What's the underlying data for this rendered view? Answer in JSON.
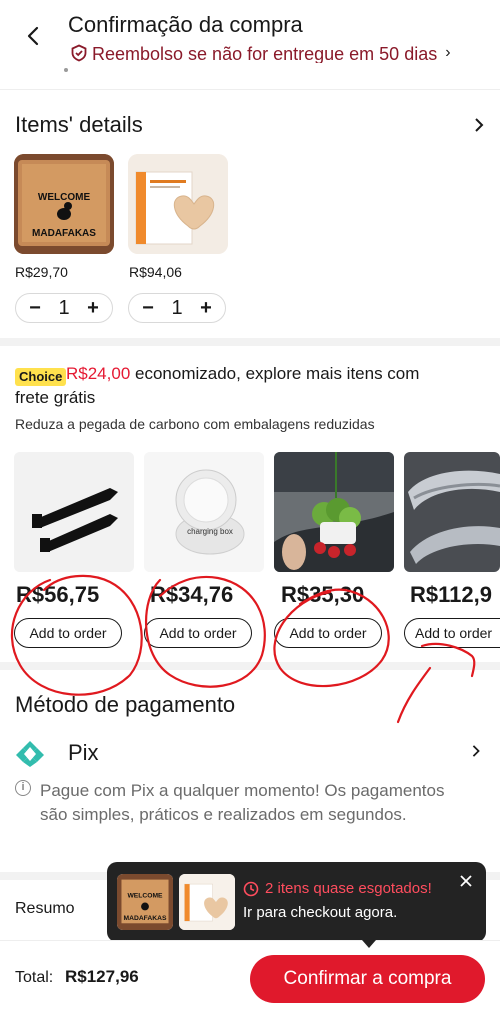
{
  "header": {
    "title": "Confirmação da compra",
    "refund_notice": "Reembolso se não for entregue em 50 dias",
    "back_icon": "chevron-left-icon"
  },
  "items": {
    "title": "Items' details",
    "products": [
      {
        "image_label": "WELCOME MADAFAKAS",
        "price": "R$29,70",
        "qty": "1"
      },
      {
        "price": "R$94,06",
        "qty": "1"
      }
    ],
    "minus": "−",
    "plus": "+"
  },
  "choice": {
    "badge": "Choice",
    "saved_amount": "R$24,00",
    "line1_rest": " economizado, explore mais itens com",
    "line2": "frete grátis",
    "subtitle": "Reduza a pegada de carbono com embalagens reduzidas",
    "recommendations": [
      {
        "price": "R$56,75",
        "button": "Add to order"
      },
      {
        "price": "R$34,76",
        "button": "Add to order",
        "image_label": "charging box"
      },
      {
        "price": "R$35,30",
        "button": "Add to order"
      },
      {
        "price": "R$112,9",
        "button": "Add to order"
      }
    ]
  },
  "payment": {
    "title": "Método de pagamento",
    "method": "Pix",
    "description": "Pague com Pix a qualquer momento! Os pagamentos são simples, práticos e realizados em segundos."
  },
  "summary": {
    "label": "Resumo"
  },
  "popup": {
    "alert": "2 itens quase esgotados!",
    "action": "Ir para checkout agora."
  },
  "footer": {
    "total_label": "Total:",
    "total_value": "R$127,96",
    "confirm_button": "Confirmar a compra"
  },
  "colors": {
    "accent": "#e0192c",
    "badge": "#ffe14d",
    "pix": "#32bcad",
    "annotation": "#e0191f"
  }
}
